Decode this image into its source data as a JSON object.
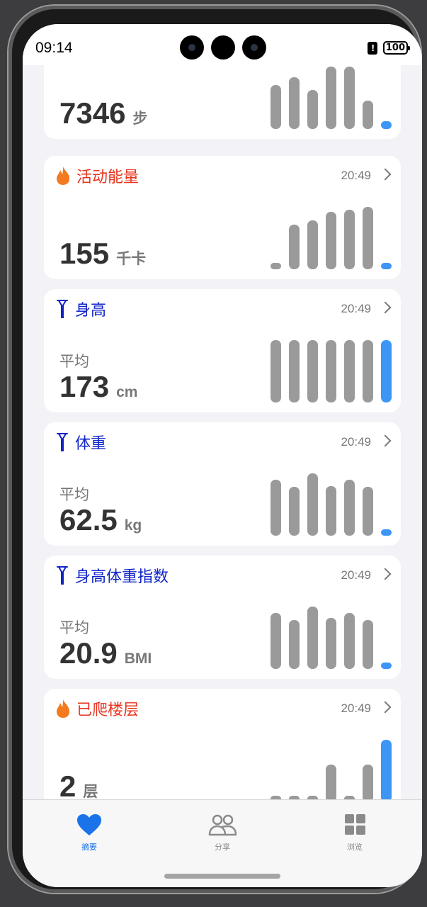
{
  "status_bar": {
    "time": "09:14",
    "battery": "100",
    "alert": "!"
  },
  "cards": [
    {
      "id": "steps",
      "title": "",
      "time": "",
      "avg_label": "",
      "value": "7346",
      "unit": "步",
      "icon": "",
      "title_color": "",
      "bars": [
        0.71,
        0.83,
        0.63,
        1.0,
        1.0,
        0.45,
        0.12
      ],
      "today_color": "#3d96f5"
    },
    {
      "id": "active-energy",
      "title": "活动能量",
      "time": "20:49",
      "avg_label": "",
      "value": "155",
      "unit": "千卡",
      "icon": "flame-icon",
      "title_color": "#e8351f",
      "bars": [
        0.1,
        0.72,
        0.78,
        0.92,
        0.95,
        1.0,
        0.1
      ],
      "today_color": "#3d96f5"
    },
    {
      "id": "height",
      "title": "身高",
      "time": "20:49",
      "avg_label": "平均",
      "value": "173",
      "unit": "cm",
      "icon": "ruler-icon",
      "title_color": "#1024c8",
      "bars": [
        1.0,
        1.0,
        1.0,
        1.0,
        1.0,
        1.0,
        1.0
      ],
      "today_color": "#3d96f5"
    },
    {
      "id": "weight",
      "title": "体重",
      "time": "20:49",
      "avg_label": "平均",
      "value": "62.5",
      "unit": "kg",
      "icon": "ruler-icon",
      "title_color": "#1024c8",
      "bars": [
        0.9,
        0.78,
        1.0,
        0.8,
        0.9,
        0.78,
        0.1
      ],
      "today_color": "#3d96f5"
    },
    {
      "id": "bmi",
      "title": "身高体重指数",
      "time": "20:49",
      "avg_label": "平均",
      "value": "20.9",
      "unit": "BMI",
      "icon": "ruler-icon",
      "title_color": "#1024c8",
      "bars": [
        0.9,
        0.78,
        1.0,
        0.82,
        0.9,
        0.78,
        0.1
      ],
      "today_color": "#3d96f5"
    },
    {
      "id": "floors",
      "title": "已爬楼层",
      "time": "20:49",
      "avg_label": "",
      "value": "2",
      "unit": "层",
      "icon": "flame-icon",
      "title_color": "#e8351f",
      "bars": [
        0.1,
        0.1,
        0.1,
        0.6,
        0.1,
        0.6,
        1.0
      ],
      "today_color": "#3d96f5"
    }
  ],
  "tabs": [
    {
      "label": "摘要",
      "icon": "heart-icon",
      "active": true
    },
    {
      "label": "分享",
      "icon": "people-icon",
      "active": false
    },
    {
      "label": "浏览",
      "icon": "grid-icon",
      "active": false
    }
  ],
  "colors": {
    "accent": "#1a73e8",
    "bar": "#9a9a9a",
    "today_bar": "#3d96f5"
  }
}
